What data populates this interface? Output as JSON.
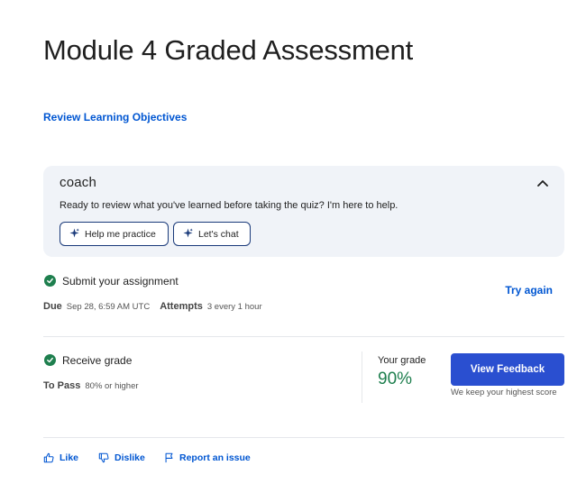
{
  "page": {
    "title": "Module 4 Graded Assessment",
    "review_link": "Review Learning Objectives"
  },
  "coach": {
    "logo": "coach",
    "message": "Ready to review what you've learned before taking the quiz? I'm here to help.",
    "buttons": {
      "practice": "Help me practice",
      "chat": "Let's chat"
    },
    "toggle_icon": "chevron-up-icon"
  },
  "submit": {
    "label": "Submit your assignment",
    "due_key": "Due",
    "due_val": "Sep 28, 6:59 AM UTC",
    "attempts_key": "Attempts",
    "attempts_val": "3 every 1 hour",
    "action": "Try again"
  },
  "grade": {
    "label": "Receive grade",
    "pass_key": "To Pass",
    "pass_val": "80% or higher",
    "your_grade_label": "Your grade",
    "value": "90%",
    "feedback_button": "View Feedback",
    "note": "We keep your highest score"
  },
  "footer": {
    "like": "Like",
    "dislike": "Dislike",
    "report": "Report an issue"
  },
  "colors": {
    "link": "#0056d2",
    "success": "#1e7f4e",
    "primary_button": "#2a4fd0",
    "coach_bg": "#f0f3f8"
  }
}
